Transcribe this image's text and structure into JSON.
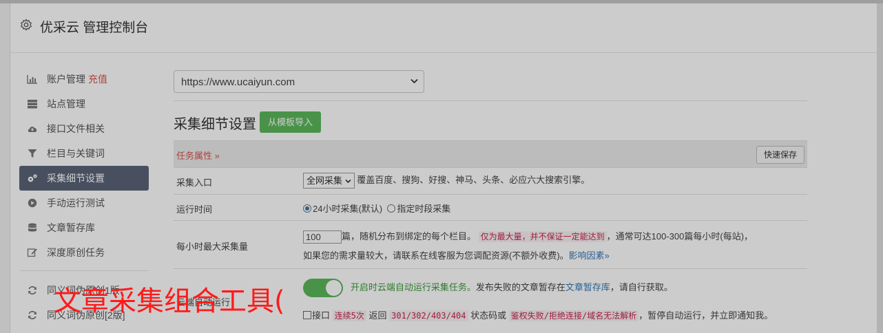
{
  "header": {
    "title": "优采云 管理控制台",
    "icon": "gear-icon"
  },
  "sidebar": {
    "items": [
      {
        "label": "账户管理",
        "extra": "充值",
        "icon": "bar-chart-icon"
      },
      {
        "label": "站点管理",
        "icon": "server-icon"
      },
      {
        "label": "接口文件相关",
        "icon": "cloud-upload-icon"
      },
      {
        "label": "栏目与关键词",
        "icon": "filter-icon"
      },
      {
        "label": "采集细节设置",
        "icon": "cogs-icon",
        "active": true
      },
      {
        "label": "手动运行测试",
        "icon": "play-circle-icon"
      },
      {
        "label": "文章暂存库",
        "icon": "database-icon"
      },
      {
        "label": "深度原创任务",
        "icon": "edit-icon"
      },
      {
        "label": "同义词伪原创1版",
        "icon": "refresh-icon"
      },
      {
        "label": "同义词伪原创[2版]",
        "icon": "refresh-icon"
      }
    ]
  },
  "main": {
    "site_select": "https://www.ucaiyun.com",
    "section_title": "采集细节设置",
    "import_button": "从模板导入",
    "task_attr_label": "任务属性 »",
    "quick_save_button": "快速保存",
    "rows": {
      "entry": {
        "label": "采集入口",
        "select_value": "全网采集",
        "desc": "覆盖百度、搜狗、好搜、神马、头条、必应六大搜索引擎。"
      },
      "run_time": {
        "label": "运行时间",
        "option1": "24小时采集(默认)",
        "option2": "指定时段采集"
      },
      "max_per_hour": {
        "label": "每小时最大采集量",
        "value": "100",
        "text1": "篇，随机分布到绑定的每个栏目。",
        "code1": "仅为最大量，并不保证一定能达到",
        "text2": "，通常可达100-300篇每小时(每站)，",
        "text3": "如果您的需求量较大，请联系在线客服为您调配资源(不额外收费)。",
        "link": "影响因素»"
      },
      "auto_run": {
        "label": "云端自动运行",
        "green_text": "开启时云端自动运行采集任务。",
        "text1": "发布失败的文章暂存在",
        "link": "文章暂存库",
        "text2": "，请自行获取。",
        "check_label": "接口",
        "code1": "连续5次",
        "text3": "返回",
        "code2": "301/302/403/404",
        "text4": "状态码或",
        "code3": "鉴权失败/拒绝连接/域名无法解析",
        "text5": "，暂停自动运行，并立即通知我。"
      }
    }
  },
  "watermark": "文章采集组合工具("
}
